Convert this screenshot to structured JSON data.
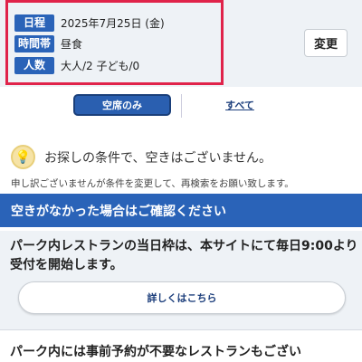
{
  "conditions": {
    "date_label": "日程",
    "date_value": "2025年7月25日 (金)",
    "time_label": "時間帯",
    "time_value": "昼食",
    "party_label": "人数",
    "party_value": "大人/2 子ども/0",
    "change_button": "変更"
  },
  "filter": {
    "available_only": "空席のみ",
    "all": "すべて"
  },
  "notice": {
    "message": "お探しの条件で、空きはございません。",
    "sub_message": "申し訳ございませんが条件を変更して、再検索をお願い致します。"
  },
  "info": {
    "header": "空きがなかった場合はご確認ください",
    "same_day_text": "パーク内レストランの当日枠は、本サイトにて毎日9:00より受付を開始します。",
    "details_button": "詳しくはこちら",
    "no_reservation_text": "パーク内には事前予約が不要なレストランもござい"
  },
  "colors": {
    "accent_blue": "#2a63b8",
    "highlight_red": "#e0234a",
    "panel_gray": "#eef2f6"
  }
}
